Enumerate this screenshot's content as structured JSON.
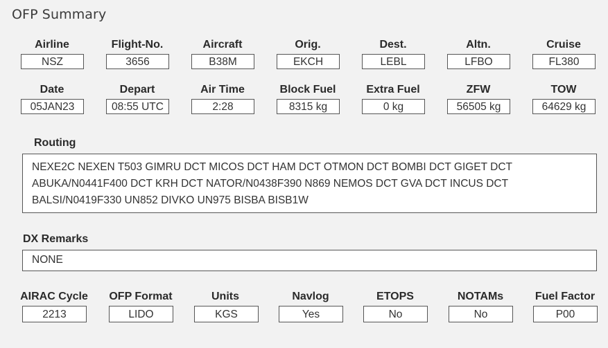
{
  "page": {
    "title": "OFP Summary"
  },
  "row1": [
    {
      "label": "Airline",
      "value": "NSZ"
    },
    {
      "label": "Flight-No.",
      "value": "3656"
    },
    {
      "label": "Aircraft",
      "value": "B38M"
    },
    {
      "label": "Orig.",
      "value": "EKCH"
    },
    {
      "label": "Dest.",
      "value": "LEBL"
    },
    {
      "label": "Altn.",
      "value": "LFBO"
    },
    {
      "label": "Cruise",
      "value": "FL380"
    }
  ],
  "row2": [
    {
      "label": "Date",
      "value": "05JAN23"
    },
    {
      "label": "Depart",
      "value": "08:55 UTC"
    },
    {
      "label": "Air Time",
      "value": "2:28"
    },
    {
      "label": "Block Fuel",
      "value": "8315 kg"
    },
    {
      "label": "Extra Fuel",
      "value": "0 kg"
    },
    {
      "label": "ZFW",
      "value": "56505 kg"
    },
    {
      "label": "TOW",
      "value": "64629 kg"
    }
  ],
  "routing": {
    "label": "Routing",
    "lines": [
      "NEXE2C NEXEN T503 GIMRU DCT MICOS DCT HAM DCT OTMON DCT BOMBI DCT GIGET DCT",
      "ABUKA/N0441F400 DCT KRH DCT NATOR/N0438F390 N869 NEMOS DCT GVA DCT INCUS DCT",
      "BALSI/N0419F330 UN852 DIVKO UN975 BISBA BISB1W"
    ]
  },
  "dx_remarks": {
    "label": "DX Remarks",
    "value": "NONE"
  },
  "row3": [
    {
      "label": "AIRAC Cycle",
      "value": "2213"
    },
    {
      "label": "OFP Format",
      "value": "LIDO"
    },
    {
      "label": "Units",
      "value": "KGS"
    },
    {
      "label": "Navlog",
      "value": "Yes"
    },
    {
      "label": "ETOPS",
      "value": "No"
    },
    {
      "label": "NOTAMs",
      "value": "No"
    },
    {
      "label": "Fuel Factor",
      "value": "P00"
    }
  ]
}
